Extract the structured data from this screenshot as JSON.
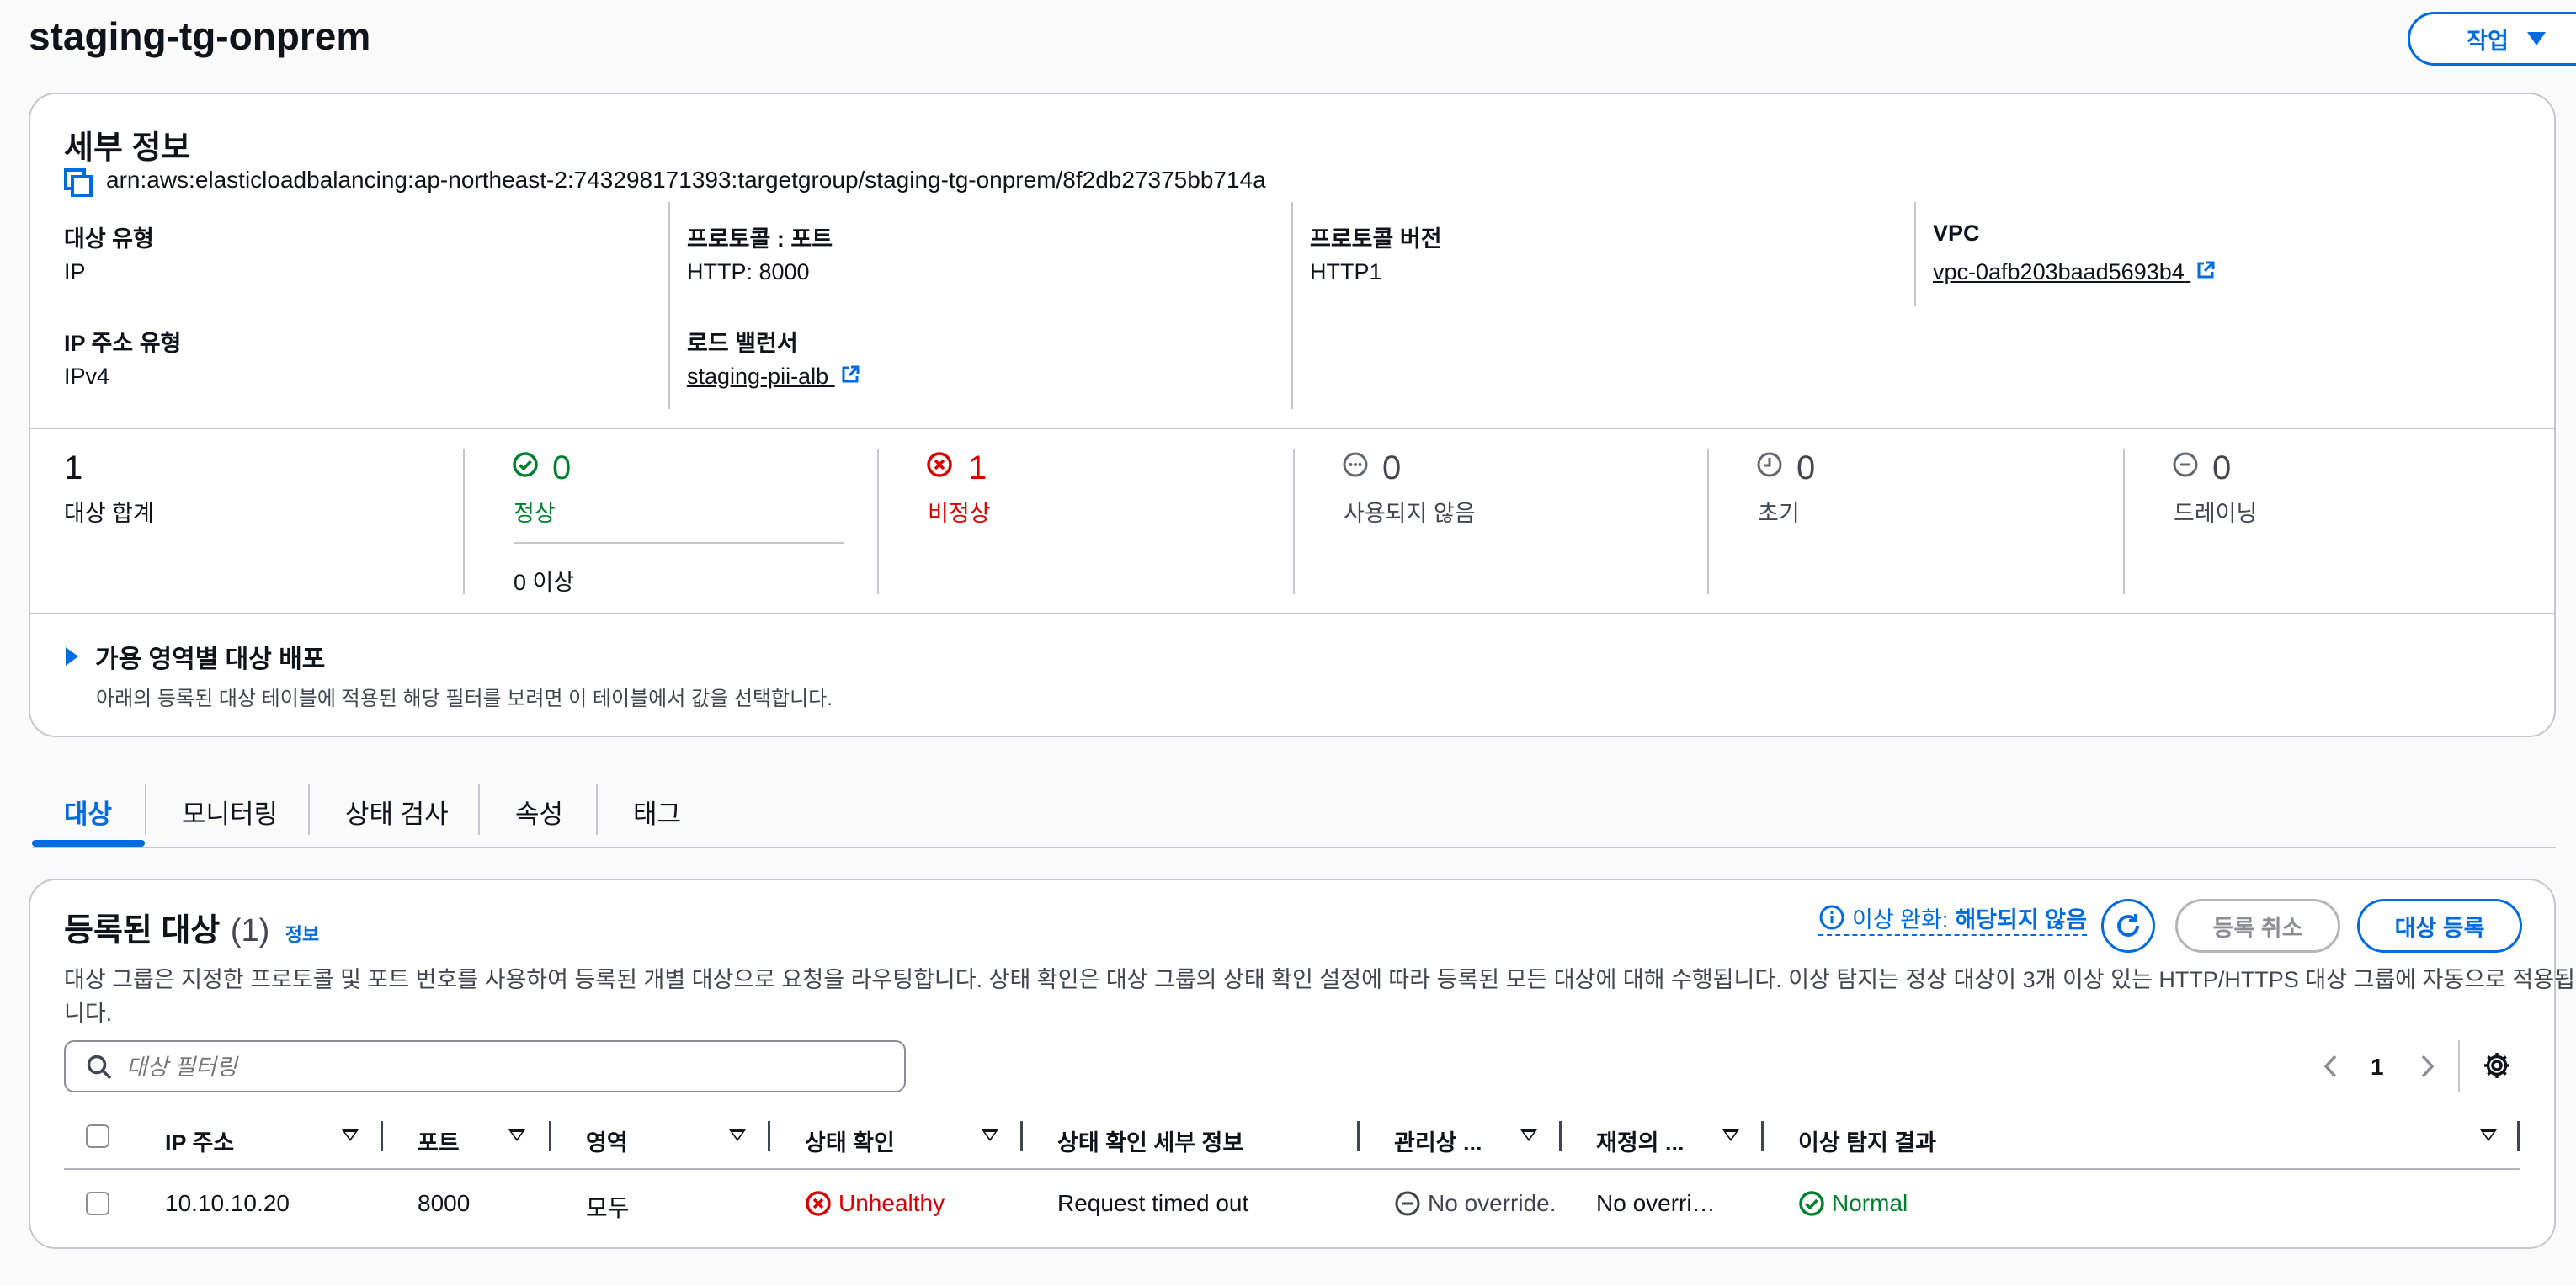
{
  "page": {
    "title": "staging-tg-onprem",
    "action_label": "작업"
  },
  "details": {
    "heading": "세부 정보",
    "arn": "arn:aws:elasticloadbalancing:ap-northeast-2:743298171393:targetgroup/staging-tg-onprem/8f2db27375bb714a",
    "target_type_label": "대상 유형",
    "target_type_value": "IP",
    "ip_type_label": "IP 주소 유형",
    "ip_type_value": "IPv4",
    "protocol_port_label": "프로토콜 : 포트",
    "protocol_port_value": "HTTP: 8000",
    "load_balancer_label": "로드 밸런서",
    "load_balancer_value": "staging-pii-alb",
    "protocol_version_label": "프로토콜 버전",
    "protocol_version_value": "HTTP1",
    "vpc_label": "VPC",
    "vpc_value": "vpc-0afb203baad5693b4"
  },
  "counts": {
    "total": {
      "value": "1",
      "label": "대상 합계"
    },
    "healthy": {
      "value": "0",
      "label": "정상",
      "sub": "0 이상"
    },
    "unhealthy": {
      "value": "1",
      "label": "비정상"
    },
    "unused": {
      "value": "0",
      "label": "사용되지 않음"
    },
    "initial": {
      "value": "0",
      "label": "초기"
    },
    "draining": {
      "value": "0",
      "label": "드레이닝"
    }
  },
  "az": {
    "title": "가용 영역별 대상 배포",
    "desc": "아래의 등록된 대상 테이블에 적용된 해당 필터를 보려면 이 테이블에서 값을 선택합니다."
  },
  "tabs": [
    "대상",
    "모니터링",
    "상태 검사",
    "속성",
    "태그"
  ],
  "registered": {
    "title": "등록된 대상",
    "count": "(1)",
    "info": "정보",
    "anomaly_label": "이상 완화:",
    "anomaly_value": "해당되지 않음",
    "deregister_label": "등록 취소",
    "register_label": "대상 등록",
    "desc_line1": "대상 그룹은 지정한 프로토콜 및 포트 번호를 사용하여 등록된 개별 대상으로 요청을 라우팅합니다. 상태 확인은 대상 그룹의 상태 확인 설정에 따라 등록된 모든 대상에 대해 수행됩니다. 이상 탐지는 정상 대상이 3개 이상 있는 HTTP/HTTPS 대상 그룹에 자동으로 적용됩",
    "desc_line2": "니다.",
    "filter_placeholder": "대상 필터링",
    "page_number": "1",
    "columns": [
      "IP 주소",
      "포트",
      "영역",
      "상태 확인",
      "상태 확인 세부 정보",
      "관리상 ...",
      "재정의 ...",
      "이상 탐지 결과"
    ],
    "rows": [
      {
        "ip": "10.10.10.20",
        "port": "8000",
        "zone": "모두",
        "health": "Unhealthy",
        "health_detail": "Request timed out",
        "admin": "No override.",
        "override": "No overri…",
        "anomaly": "Normal"
      }
    ]
  },
  "colors": {
    "link": "#006ce0",
    "success": "#00802f",
    "error": "#db0000",
    "muted": "#656871",
    "border": "#c6c6cd"
  }
}
